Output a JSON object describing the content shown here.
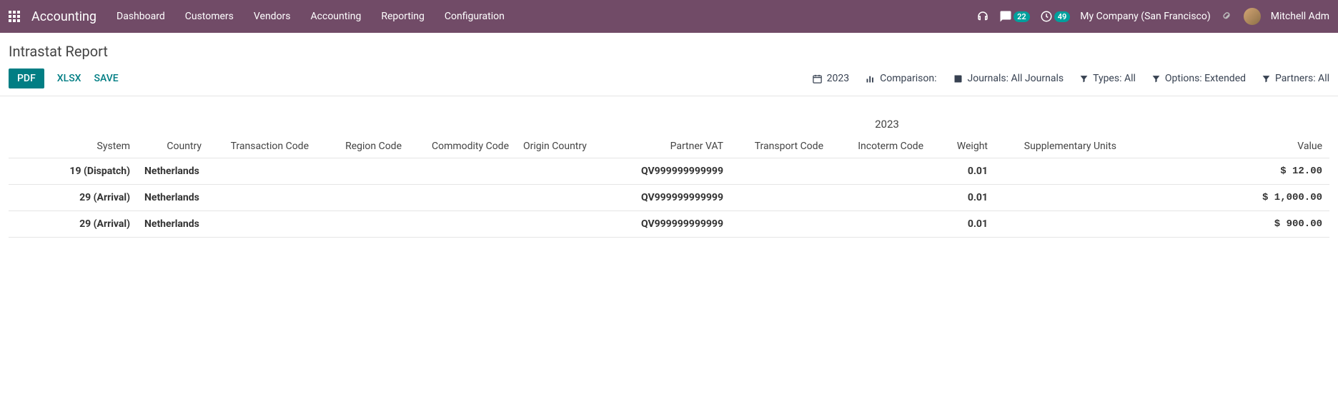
{
  "header": {
    "app_title": "Accounting",
    "nav": [
      "Dashboard",
      "Customers",
      "Vendors",
      "Accounting",
      "Reporting",
      "Configuration"
    ],
    "messages_count": "22",
    "activities_count": "49",
    "company": "My Company (San Francisco)",
    "user": "Mitchell Adm"
  },
  "page": {
    "title": "Intrastat Report"
  },
  "toolbar": {
    "pdf": "PDF",
    "xlsx": "XLSX",
    "save": "SAVE"
  },
  "filters": {
    "date": "2023",
    "comparison": "Comparison:",
    "journals": "Journals: All Journals",
    "types": "Types: All",
    "options": "Options: Extended",
    "partners": "Partners: All"
  },
  "report": {
    "year": "2023",
    "columns": {
      "system": "System",
      "country": "Country",
      "transaction_code": "Transaction Code",
      "region_code": "Region Code",
      "commodity_code": "Commodity Code",
      "origin_country": "Origin Country",
      "partner_vat": "Partner VAT",
      "transport_code": "Transport Code",
      "incoterm_code": "Incoterm Code",
      "weight": "Weight",
      "supplementary_units": "Supplementary Units",
      "value": "Value"
    },
    "rows": [
      {
        "system": "19 (Dispatch)",
        "country": "Netherlands",
        "transaction_code": "",
        "region_code": "",
        "commodity_code": "",
        "origin_country": "",
        "partner_vat": "QV999999999999",
        "transport_code": "",
        "incoterm_code": "",
        "weight": "0.01",
        "supplementary_units": "",
        "value": "$ 12.00"
      },
      {
        "system": "29 (Arrival)",
        "country": "Netherlands",
        "transaction_code": "",
        "region_code": "",
        "commodity_code": "",
        "origin_country": "",
        "partner_vat": "QV999999999999",
        "transport_code": "",
        "incoterm_code": "",
        "weight": "0.01",
        "supplementary_units": "",
        "value": "$ 1,000.00"
      },
      {
        "system": "29 (Arrival)",
        "country": "Netherlands",
        "transaction_code": "",
        "region_code": "",
        "commodity_code": "",
        "origin_country": "",
        "partner_vat": "QV999999999999",
        "transport_code": "",
        "incoterm_code": "",
        "weight": "0.01",
        "supplementary_units": "",
        "value": "$ 900.00"
      }
    ]
  }
}
